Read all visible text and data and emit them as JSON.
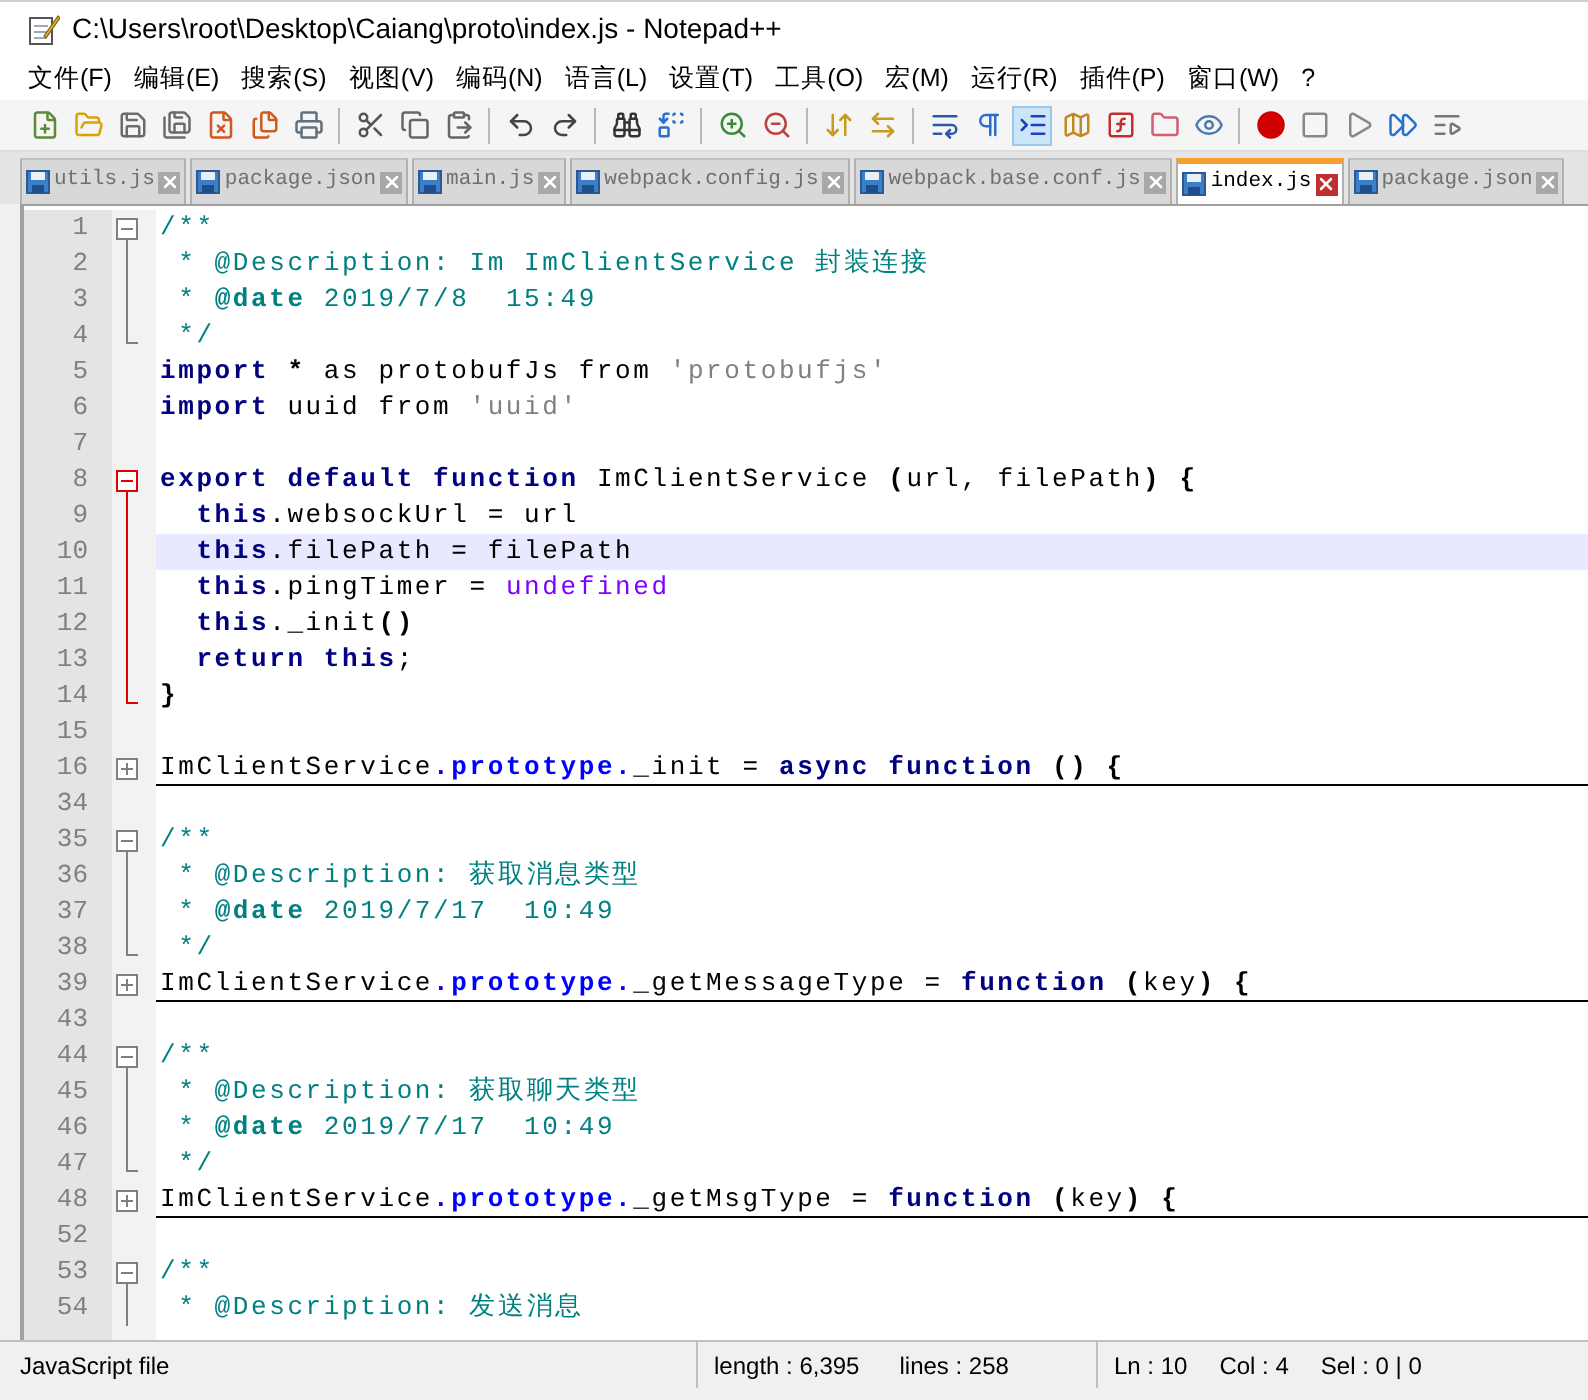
{
  "window": {
    "title": "C:\\Users\\root\\Desktop\\Caiang\\proto\\index.js - Notepad++"
  },
  "menu": [
    "文件(F)",
    "编辑(E)",
    "搜索(S)",
    "视图(V)",
    "编码(N)",
    "语言(L)",
    "设置(T)",
    "工具(O)",
    "宏(M)",
    "运行(R)",
    "插件(P)",
    "窗口(W)",
    "?"
  ],
  "toolbar": [
    {
      "kind": "button",
      "pressed": false
    },
    {
      "kind": "button",
      "pressed": false
    },
    {
      "kind": "button",
      "pressed": false
    },
    {
      "kind": "button",
      "pressed": false
    },
    {
      "kind": "button",
      "pressed": false
    },
    {
      "kind": "button",
      "pressed": false
    },
    {
      "kind": "button",
      "pressed": false
    },
    {
      "kind": "separator"
    },
    {
      "kind": "button",
      "pressed": false
    },
    {
      "kind": "button",
      "pressed": false
    },
    {
      "kind": "button",
      "pressed": false
    },
    {
      "kind": "separator"
    },
    {
      "kind": "button",
      "pressed": false
    },
    {
      "kind": "button",
      "pressed": false
    },
    {
      "kind": "separator"
    },
    {
      "kind": "button",
      "pressed": false
    },
    {
      "kind": "button",
      "pressed": false
    },
    {
      "kind": "separator"
    },
    {
      "kind": "button",
      "pressed": false
    },
    {
      "kind": "button",
      "pressed": false
    },
    {
      "kind": "separator"
    },
    {
      "kind": "button",
      "pressed": false
    },
    {
      "kind": "button",
      "pressed": false
    },
    {
      "kind": "separator"
    },
    {
      "kind": "button",
      "pressed": false
    },
    {
      "kind": "button",
      "pressed": false
    },
    {
      "kind": "button",
      "pressed": true
    },
    {
      "kind": "button",
      "pressed": false
    },
    {
      "kind": "button",
      "pressed": false
    },
    {
      "kind": "button",
      "pressed": false
    },
    {
      "kind": "button",
      "pressed": false
    },
    {
      "kind": "separator"
    },
    {
      "kind": "button",
      "pressed": false
    },
    {
      "kind": "button",
      "pressed": false
    },
    {
      "kind": "button",
      "pressed": false
    },
    {
      "kind": "button",
      "pressed": false
    },
    {
      "kind": "button",
      "pressed": false
    }
  ],
  "tabs": [
    {
      "label": "utils.js",
      "selected": false
    },
    {
      "label": "package.json",
      "selected": false
    },
    {
      "label": "main.js",
      "selected": false
    },
    {
      "label": "webpack.config.js",
      "selected": false
    },
    {
      "label": "webpack.base.conf.js",
      "selected": false
    },
    {
      "label": "index.js",
      "selected": true
    },
    {
      "label": "package.json",
      "selected": false
    }
  ],
  "editor": {
    "lines": [
      {
        "number": "1",
        "kind": "fold-start",
        "fold_active": false,
        "current": false,
        "folded": false,
        "tokens": [
          {
            "kind": "comment",
            "text": "/**"
          }
        ]
      },
      {
        "number": "2",
        "kind": "fold-body",
        "fold_active": false,
        "current": false,
        "folded": false,
        "tokens": [
          {
            "kind": "comment",
            "text": " * @Description: Im ImClientService 封装连接"
          }
        ]
      },
      {
        "number": "3",
        "kind": "fold-body",
        "fold_active": false,
        "current": false,
        "folded": false,
        "tokens": [
          {
            "kind": "comment",
            "text": " * "
          },
          {
            "kind": "doctag",
            "text": "@date"
          },
          {
            "kind": "comment",
            "text": " 2019/7/8  15:49"
          }
        ]
      },
      {
        "number": "4",
        "kind": "fold-end",
        "fold_active": false,
        "current": false,
        "folded": false,
        "tokens": [
          {
            "kind": "comment",
            "text": " */"
          }
        ]
      },
      {
        "number": "5",
        "kind": "plain",
        "current": false,
        "folded": false,
        "tokens": [
          {
            "kind": "keyword",
            "text": "import"
          },
          {
            "kind": "operator",
            "text": " *"
          },
          {
            "kind": "plain",
            "text": " as protobufJs from "
          },
          {
            "kind": "string",
            "text": "'protobufjs'"
          }
        ]
      },
      {
        "number": "6",
        "kind": "plain",
        "current": false,
        "folded": false,
        "tokens": [
          {
            "kind": "keyword",
            "text": "import"
          },
          {
            "kind": "plain",
            "text": " uuid from "
          },
          {
            "kind": "string",
            "text": "'uuid'"
          }
        ]
      },
      {
        "number": "7",
        "kind": "plain"
      },
      {
        "number": "8",
        "kind": "fold-start",
        "fold_active": true,
        "current": false,
        "folded": false,
        "tokens": [
          {
            "kind": "keyword",
            "text": "export default function"
          },
          {
            "kind": "plain",
            "text": " ImClientService "
          },
          {
            "kind": "operator",
            "text": "("
          },
          {
            "kind": "plain",
            "text": "url, filePath"
          },
          {
            "kind": "operator",
            "text": ") {"
          }
        ]
      },
      {
        "number": "9",
        "kind": "fold-body",
        "fold_active": true,
        "current": false,
        "folded": false,
        "tokens": [
          {
            "kind": "keyword",
            "text": "  this"
          },
          {
            "kind": "plain",
            "text": ".websockUrl = url"
          }
        ]
      },
      {
        "number": "10",
        "kind": "fold-body",
        "fold_active": true,
        "current": true,
        "folded": false,
        "tokens": [
          {
            "kind": "keyword",
            "text": "  this"
          },
          {
            "kind": "plain",
            "text": ".filePath = filePath"
          }
        ]
      },
      {
        "number": "11",
        "kind": "fold-body",
        "fold_active": true,
        "current": false,
        "folded": false,
        "tokens": [
          {
            "kind": "keyword",
            "text": "  this"
          },
          {
            "kind": "plain",
            "text": ".pingTimer = "
          },
          {
            "kind": "constant",
            "text": "undefined"
          }
        ]
      },
      {
        "number": "12",
        "kind": "fold-body",
        "fold_active": true,
        "current": false,
        "folded": false,
        "tokens": [
          {
            "kind": "keyword",
            "text": "  this"
          },
          {
            "kind": "plain",
            "text": "._init"
          },
          {
            "kind": "operator",
            "text": "()"
          }
        ]
      },
      {
        "number": "13",
        "kind": "fold-body",
        "fold_active": true,
        "current": false,
        "folded": false,
        "tokens": [
          {
            "kind": "keyword",
            "text": "  return this"
          },
          {
            "kind": "plain",
            "text": ";"
          }
        ]
      },
      {
        "number": "14",
        "kind": "fold-end",
        "fold_active": true,
        "current": false,
        "folded": false,
        "tokens": [
          {
            "kind": "operator",
            "text": "}"
          }
        ]
      },
      {
        "number": "15",
        "kind": "plain"
      },
      {
        "number": "16",
        "kind": "fold-closed",
        "fold_active": false,
        "current": false,
        "folded": true,
        "tokens": [
          {
            "kind": "plain",
            "text": "ImClientService"
          },
          {
            "kind": "member",
            "text": ".prototype."
          },
          {
            "kind": "plain",
            "text": "_init = "
          },
          {
            "kind": "keyword",
            "text": "async function"
          },
          {
            "kind": "operator",
            "text": " () {"
          }
        ]
      },
      {
        "number": "34",
        "kind": "plain"
      },
      {
        "number": "35",
        "kind": "fold-start",
        "fold_active": false,
        "current": false,
        "folded": false,
        "tokens": [
          {
            "kind": "comment",
            "text": "/**"
          }
        ]
      },
      {
        "number": "36",
        "kind": "fold-body",
        "fold_active": false,
        "current": false,
        "folded": false,
        "tokens": [
          {
            "kind": "comment",
            "text": " * @Description: 获取消息类型"
          }
        ]
      },
      {
        "number": "37",
        "kind": "fold-body",
        "fold_active": false,
        "current": false,
        "folded": false,
        "tokens": [
          {
            "kind": "comment",
            "text": " * "
          },
          {
            "kind": "doctag",
            "text": "@date"
          },
          {
            "kind": "comment",
            "text": " 2019/7/17  10:49"
          }
        ]
      },
      {
        "number": "38",
        "kind": "fold-end",
        "fold_active": false,
        "current": false,
        "folded": false,
        "tokens": [
          {
            "kind": "comment",
            "text": " */"
          }
        ]
      },
      {
        "number": "39",
        "kind": "fold-closed",
        "fold_active": false,
        "current": false,
        "folded": true,
        "tokens": [
          {
            "kind": "plain",
            "text": "ImClientService"
          },
          {
            "kind": "member",
            "text": ".prototype."
          },
          {
            "kind": "plain",
            "text": "_getMessageType = "
          },
          {
            "kind": "keyword",
            "text": "function"
          },
          {
            "kind": "operator",
            "text": " ("
          },
          {
            "kind": "plain",
            "text": "key"
          },
          {
            "kind": "operator",
            "text": ") {"
          }
        ]
      },
      {
        "number": "43",
        "kind": "plain"
      },
      {
        "number": "44",
        "kind": "fold-start",
        "fold_active": false,
        "current": false,
        "folded": false,
        "tokens": [
          {
            "kind": "comment",
            "text": "/**"
          }
        ]
      },
      {
        "number": "45",
        "kind": "fold-body",
        "fold_active": false,
        "current": false,
        "folded": false,
        "tokens": [
          {
            "kind": "comment",
            "text": " * @Description: 获取聊天类型"
          }
        ]
      },
      {
        "number": "46",
        "kind": "fold-body",
        "fold_active": false,
        "current": false,
        "folded": false,
        "tokens": [
          {
            "kind": "comment",
            "text": " * "
          },
          {
            "kind": "doctag",
            "text": "@date"
          },
          {
            "kind": "comment",
            "text": " 2019/7/17  10:49"
          }
        ]
      },
      {
        "number": "47",
        "kind": "fold-end",
        "fold_active": false,
        "current": false,
        "folded": false,
        "tokens": [
          {
            "kind": "comment",
            "text": " */"
          }
        ]
      },
      {
        "number": "48",
        "kind": "fold-closed",
        "fold_active": false,
        "current": false,
        "folded": true,
        "tokens": [
          {
            "kind": "plain",
            "text": "ImClientService"
          },
          {
            "kind": "member",
            "text": ".prototype."
          },
          {
            "kind": "plain",
            "text": "_getMsgType = "
          },
          {
            "kind": "keyword",
            "text": "function"
          },
          {
            "kind": "operator",
            "text": " ("
          },
          {
            "kind": "plain",
            "text": "key"
          },
          {
            "kind": "operator",
            "text": ") {"
          }
        ]
      },
      {
        "number": "52",
        "kind": "plain"
      },
      {
        "number": "53",
        "kind": "fold-start",
        "fold_active": false,
        "current": false,
        "folded": false,
        "tokens": [
          {
            "kind": "comment",
            "text": "/**"
          }
        ]
      },
      {
        "number": "54",
        "kind": "fold-body",
        "fold_active": false,
        "current": false,
        "folded": false,
        "tokens": [
          {
            "kind": "comment",
            "text": " * @Description: 发送消息"
          }
        ]
      }
    ]
  },
  "status_bar": {
    "file_type": "JavaScript file",
    "length": "length : 6,395",
    "lines": "lines : 258",
    "ln": "Ln : 10",
    "col": "Col : 4",
    "sel": "Sel : 0 | 0"
  }
}
